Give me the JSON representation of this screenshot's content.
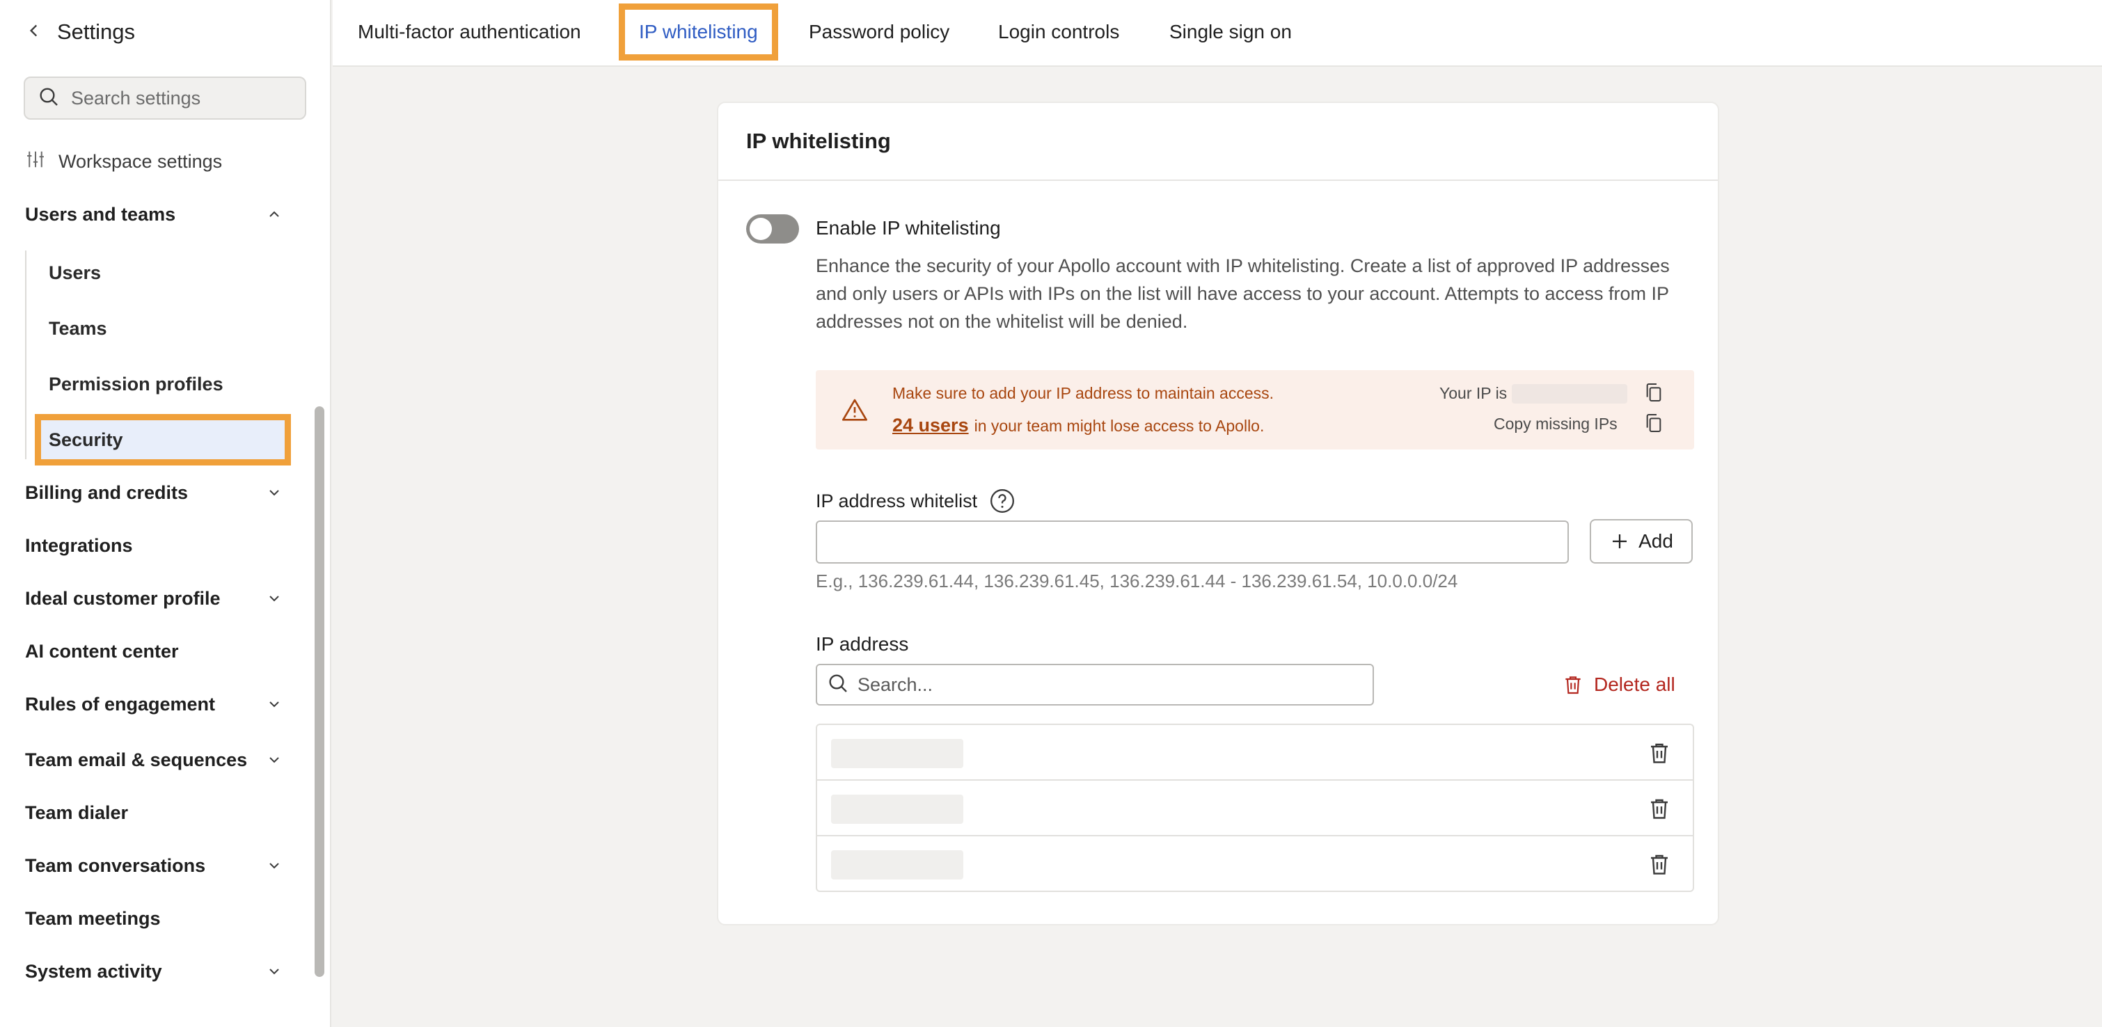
{
  "sidebar": {
    "title": "Settings",
    "search_placeholder": "Search settings",
    "workspace_settings": "Workspace settings",
    "groups": [
      {
        "label": "Users and teams"
      },
      {
        "label": "Billing and credits"
      },
      {
        "label": "Integrations"
      },
      {
        "label": "Ideal customer profile"
      },
      {
        "label": "AI content center"
      },
      {
        "label": "Rules of engagement"
      },
      {
        "label": "Team email & sequences"
      },
      {
        "label": "Team dialer"
      },
      {
        "label": "Team conversations"
      },
      {
        "label": "Team meetings"
      },
      {
        "label": "System activity"
      }
    ],
    "subitems": [
      {
        "label": "Users"
      },
      {
        "label": "Teams"
      },
      {
        "label": "Permission profiles"
      },
      {
        "label": "Security"
      }
    ]
  },
  "tabs": [
    {
      "label": "Multi-factor authentication"
    },
    {
      "label": "IP whitelisting"
    },
    {
      "label": "Password policy"
    },
    {
      "label": "Login controls"
    },
    {
      "label": "Single sign on"
    }
  ],
  "card": {
    "title": "IP whitelisting",
    "toggle_label": "Enable IP whitelisting",
    "description": "Enhance the security of your Apollo account with IP whitelisting. Create a list of approved IP addresses and only users or APIs with IPs on the list will have access to your account. Attempts to access from IP addresses not on the whitelist will be denied.",
    "alert": {
      "line1": "Make sure to add your IP address to maintain access.",
      "users_link": "24 users",
      "line2_rest": "in your team might lose access to Apollo.",
      "your_ip_label": "Your IP is",
      "copy_missing": "Copy missing IPs"
    },
    "whitelist_label": "IP address whitelist",
    "add_label": "Add",
    "hint": "E.g., 136.239.61.44, 136.239.61.45, 136.239.61.44 - 136.239.61.54, 10.0.0.0/24",
    "ip_address_label": "IP address",
    "search_placeholder": "Search...",
    "delete_all": "Delete all"
  },
  "colors": {
    "accent": "#2f5cc3",
    "highlight": "#f0a03a",
    "warning_text": "#a8460f",
    "warning_bg": "#fbefe9",
    "danger": "#b3261e"
  }
}
